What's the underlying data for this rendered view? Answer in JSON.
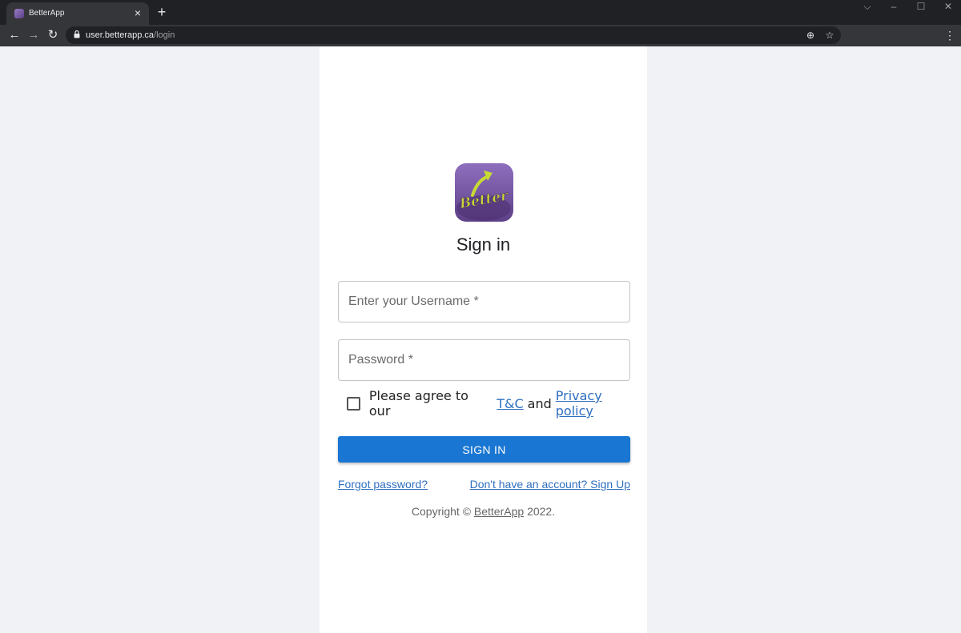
{
  "browser": {
    "tab_title": "BetterApp",
    "tab_close": "×",
    "new_tab": "+",
    "url_domain": "user.betterapp.ca",
    "url_path": "/login"
  },
  "logo": {
    "text": "Better"
  },
  "page": {
    "title": "Sign in",
    "username_placeholder": "Enter your Username *",
    "password_placeholder": "Password *",
    "agree_prefix": "Please agree to our",
    "tc_link": "T&C",
    "and": "and",
    "privacy_link": "Privacy policy",
    "signin_button": "SIGN IN",
    "forgot_link": "Forgot password?",
    "signup_link": "Don't have an account? Sign Up",
    "copyright_prefix": "Copyright ©",
    "copyright_brand": "BetterApp",
    "copyright_year": "2022."
  },
  "colors": {
    "primary": "#1976d2",
    "link": "#2f6fbf",
    "logo_purple": "#7a5aa6"
  }
}
